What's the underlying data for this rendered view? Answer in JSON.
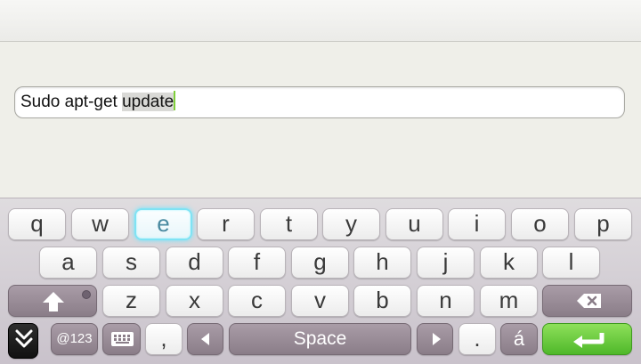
{
  "input": {
    "text_before": "Sudo apt-get ",
    "text_selected": "update"
  },
  "keyboard": {
    "row1": [
      "q",
      "w",
      "e",
      "r",
      "t",
      "y",
      "u",
      "i",
      "o",
      "p"
    ],
    "row2": [
      "a",
      "s",
      "d",
      "f",
      "g",
      "h",
      "j",
      "k",
      "l"
    ],
    "row3": [
      "z",
      "x",
      "c",
      "v",
      "b",
      "n",
      "m"
    ],
    "active_key": "e",
    "symbols_label": "@123",
    "comma_label": ",",
    "space_label": "Space",
    "period_label": ".",
    "accent_label": "á",
    "colors": {
      "key_highlight": "#7fe3f4",
      "enter": "#5cc234",
      "modifier": "#9a8c98"
    }
  }
}
